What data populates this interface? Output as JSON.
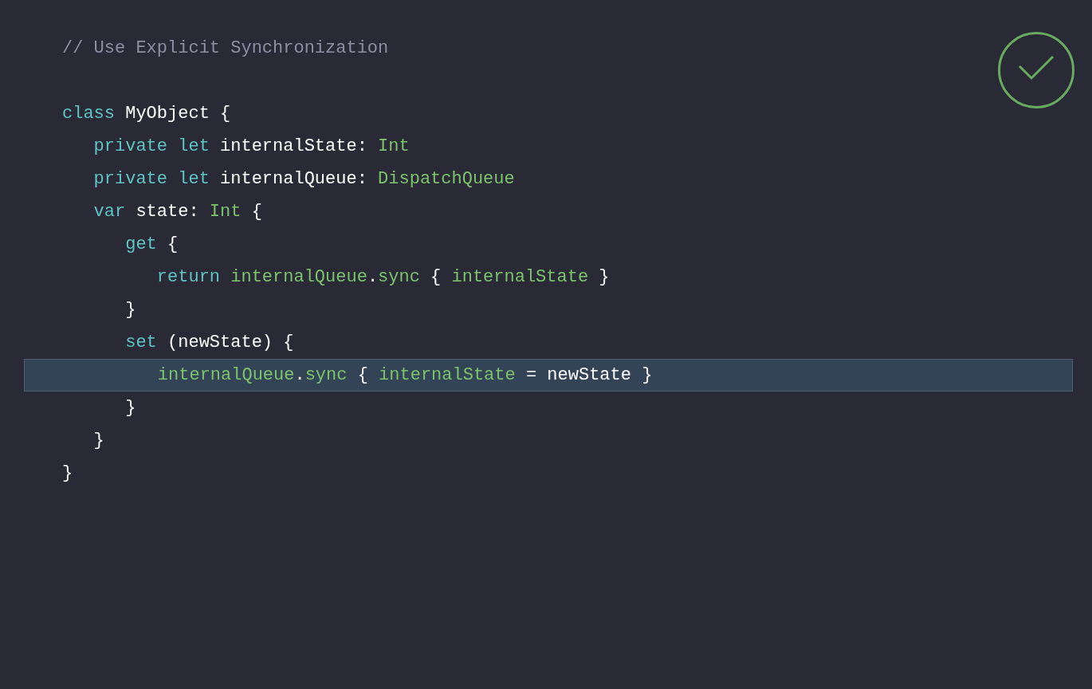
{
  "comment": "// Use Explicit Synchronization",
  "status_icon": {
    "kind": "check"
  },
  "lines": [
    {
      "highlighted": false,
      "tokens": [
        {
          "kind": "keyword",
          "text": "class"
        },
        {
          "kind": "plain",
          "text": " MyObject {"
        }
      ]
    },
    {
      "highlighted": false,
      "tokens": [
        {
          "kind": "keyword",
          "text": "   private let"
        },
        {
          "kind": "plain",
          "text": " internalState: "
        },
        {
          "kind": "type",
          "text": "Int"
        }
      ]
    },
    {
      "highlighted": false,
      "tokens": [
        {
          "kind": "keyword",
          "text": "   private let"
        },
        {
          "kind": "plain",
          "text": " internalQueue: "
        },
        {
          "kind": "type",
          "text": "DispatchQueue"
        }
      ]
    },
    {
      "highlighted": false,
      "tokens": [
        {
          "kind": "keyword",
          "text": "   var"
        },
        {
          "kind": "plain",
          "text": " state: "
        },
        {
          "kind": "type",
          "text": "Int"
        },
        {
          "kind": "plain",
          "text": " {"
        }
      ]
    },
    {
      "highlighted": false,
      "tokens": [
        {
          "kind": "keyword",
          "text": "      get"
        },
        {
          "kind": "plain",
          "text": " {"
        }
      ]
    },
    {
      "highlighted": false,
      "tokens": [
        {
          "kind": "keyword",
          "text": "         return "
        },
        {
          "kind": "type",
          "text": "internalQueue"
        },
        {
          "kind": "plain",
          "text": "."
        },
        {
          "kind": "type",
          "text": "sync"
        },
        {
          "kind": "plain",
          "text": " { "
        },
        {
          "kind": "type",
          "text": "internalState"
        },
        {
          "kind": "plain",
          "text": " }"
        }
      ]
    },
    {
      "highlighted": false,
      "tokens": [
        {
          "kind": "plain",
          "text": "      }"
        }
      ]
    },
    {
      "highlighted": false,
      "tokens": [
        {
          "kind": "keyword",
          "text": "      set"
        },
        {
          "kind": "plain",
          "text": " (newState) {"
        }
      ]
    },
    {
      "highlighted": true,
      "tokens": [
        {
          "kind": "type",
          "text": "         internalQueue"
        },
        {
          "kind": "plain",
          "text": "."
        },
        {
          "kind": "type",
          "text": "sync"
        },
        {
          "kind": "plain",
          "text": " { "
        },
        {
          "kind": "type",
          "text": "internalState"
        },
        {
          "kind": "plain",
          "text": " = newState }"
        }
      ]
    },
    {
      "highlighted": false,
      "tokens": [
        {
          "kind": "plain",
          "text": "      }"
        }
      ]
    },
    {
      "highlighted": false,
      "tokens": [
        {
          "kind": "plain",
          "text": "   }"
        }
      ]
    },
    {
      "highlighted": false,
      "tokens": [
        {
          "kind": "plain",
          "text": "}"
        }
      ]
    }
  ]
}
